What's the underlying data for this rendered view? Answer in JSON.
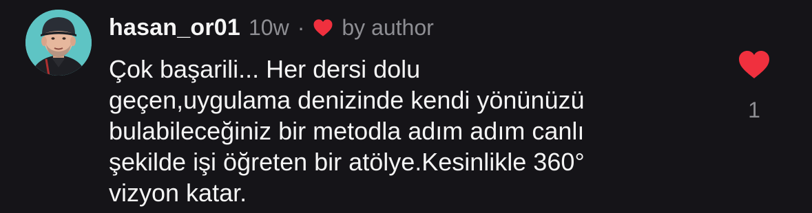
{
  "comment": {
    "username": "hasan_or01",
    "timestamp": "10w",
    "separator": "·",
    "liked_by_author_label": "by author",
    "text": "Çok başarili... Her dersi dolu\ngeçen,uygulama denizinde kendi yönünüzü\nbulabileceğiniz bir metodla adım adım canlı\nşekilde işi öğreten bir atölye.Kesinlikle 360°\nvizyon katar.",
    "like_count": "1",
    "icons": {
      "author_like": "heart-icon",
      "like_button": "heart-icon"
    },
    "colors": {
      "background": "#151418",
      "heart": "#f0303e",
      "secondary_text": "#8e8e93",
      "avatar_bg": "#5ec4c4"
    }
  }
}
